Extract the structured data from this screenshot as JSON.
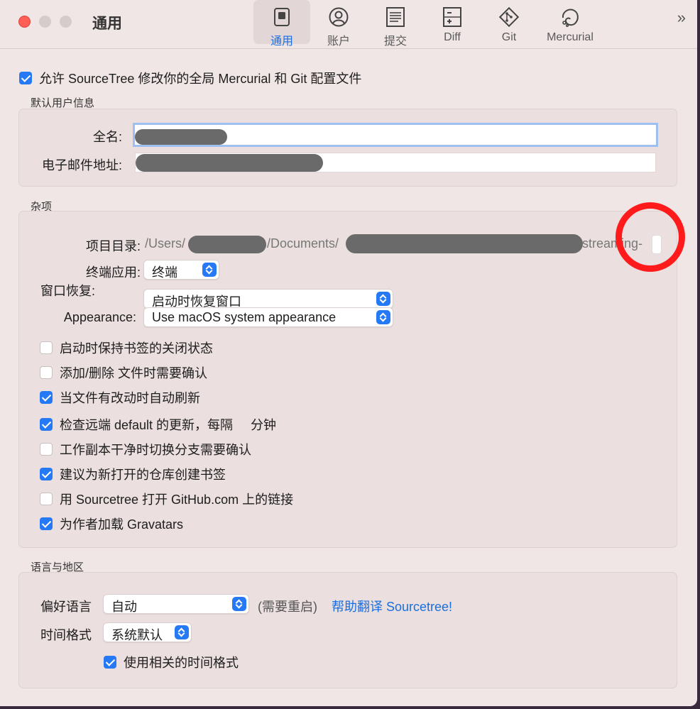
{
  "window": {
    "title": "通用"
  },
  "toolbar": {
    "items": [
      {
        "label": "通用",
        "icon": "general-switch-icon",
        "active": true
      },
      {
        "label": "账户",
        "icon": "account-person-icon",
        "active": false
      },
      {
        "label": "提交",
        "icon": "commit-document-icon",
        "active": false
      },
      {
        "label": "Diff",
        "icon": "diff-icon",
        "active": false
      },
      {
        "label": "Git",
        "icon": "git-diamond-icon",
        "active": false
      },
      {
        "label": "Mercurial",
        "icon": "mercurial-icon",
        "active": false
      }
    ],
    "overflow": "»"
  },
  "global_config": {
    "checked": true,
    "label": "允许 SourceTree 修改你的全局 Mercurial 和 Git 配置文件"
  },
  "user_info": {
    "section_title": "默认用户信息",
    "full_name_label": "全名:",
    "email_label": "电子邮件地址:"
  },
  "misc": {
    "section_title": "杂项",
    "project_dir_label": "项目目录:",
    "project_dir_parts": {
      "users": "/Users/",
      "documents": "/Documents/",
      "tail": "streaming-"
    },
    "terminal_label": "终端应用:",
    "terminal_value": "终端",
    "window_restore_label": "窗口恢复:",
    "window_restore_value": "启动时恢复窗口",
    "appearance_label": "Appearance:",
    "appearance_value": "Use macOS system appearance",
    "options": [
      {
        "checked": false,
        "label": "启动时保持书签的关闭状态"
      },
      {
        "checked": false,
        "label": "添加/删除 文件时需要确认"
      },
      {
        "checked": true,
        "label": "当文件有改动时自动刷新"
      },
      {
        "checked": true,
        "label": "检查远端 default 的更新，每隔     分钟"
      },
      {
        "checked": false,
        "label": "工作副本干净时切换分支需要确认"
      },
      {
        "checked": true,
        "label": "建议为新打开的仓库创建书签"
      },
      {
        "checked": false,
        "label": "用 Sourcetree 打开 GitHub.com 上的链接"
      },
      {
        "checked": true,
        "label": "为作者加载 Gravatars"
      }
    ]
  },
  "locale": {
    "section_title": "语言与地区",
    "language_label": "偏好语言",
    "language_value": "自动",
    "restart_note": "(需要重启)",
    "translate_link": "帮助翻译 Sourcetree!",
    "time_format_label": "时间格式",
    "time_format_value": "系统默认",
    "relative_time": {
      "checked": true,
      "label": "使用相关的时间格式"
    }
  },
  "colors": {
    "accent": "#2579f5",
    "annotation_circle": "#ff1b1b"
  }
}
